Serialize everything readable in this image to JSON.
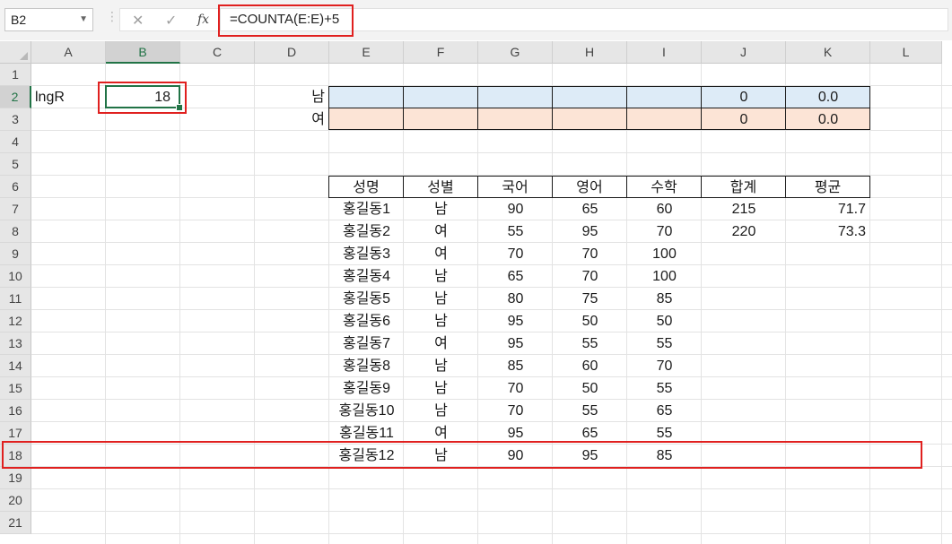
{
  "formula_bar": {
    "name_box": "B2",
    "cancel_icon": "✕",
    "enter_icon": "✓",
    "fx_label": "fx",
    "formula": "=COUNTA(E:E)+5"
  },
  "columns": [
    "A",
    "B",
    "C",
    "D",
    "E",
    "F",
    "G",
    "H",
    "I",
    "J",
    "K",
    "L"
  ],
  "rows": [
    "1",
    "2",
    "3",
    "4",
    "5",
    "6",
    "7",
    "8",
    "9",
    "10",
    "11",
    "12",
    "13",
    "14",
    "15",
    "16",
    "17",
    "18",
    "19",
    "20",
    "21"
  ],
  "selected": {
    "column": "B",
    "row": "2"
  },
  "cells": {
    "a2": "lngR",
    "b2": "18",
    "d2": "남",
    "d3": "여",
    "j2": "0",
    "k2": "0.0",
    "j3": "0",
    "k3": "0.0"
  },
  "table": {
    "headers": [
      "성명",
      "성별",
      "국어",
      "영어",
      "수학",
      "합계",
      "평균"
    ],
    "rows": [
      [
        "홍길동1",
        "남",
        "90",
        "65",
        "60",
        "215",
        "71.7"
      ],
      [
        "홍길동2",
        "여",
        "55",
        "95",
        "70",
        "220",
        "73.3"
      ],
      [
        "홍길동3",
        "여",
        "70",
        "70",
        "100",
        "",
        ""
      ],
      [
        "홍길동4",
        "남",
        "65",
        "70",
        "100",
        "",
        ""
      ],
      [
        "홍길동5",
        "남",
        "80",
        "75",
        "85",
        "",
        ""
      ],
      [
        "홍길동6",
        "남",
        "95",
        "50",
        "50",
        "",
        ""
      ],
      [
        "홍길동7",
        "여",
        "95",
        "55",
        "55",
        "",
        ""
      ],
      [
        "홍길동8",
        "남",
        "85",
        "60",
        "70",
        "",
        ""
      ],
      [
        "홍길동9",
        "남",
        "70",
        "50",
        "55",
        "",
        ""
      ],
      [
        "홍길동10",
        "남",
        "70",
        "55",
        "65",
        "",
        ""
      ],
      [
        "홍길동11",
        "여",
        "95",
        "65",
        "55",
        "",
        ""
      ],
      [
        "홍길동12",
        "남",
        "90",
        "95",
        "85",
        "",
        ""
      ]
    ]
  },
  "colors": {
    "accent_green": "#217346",
    "highlight_red": "#e0201f",
    "male_fill": "#ddebf7",
    "female_fill": "#fce4d6"
  }
}
